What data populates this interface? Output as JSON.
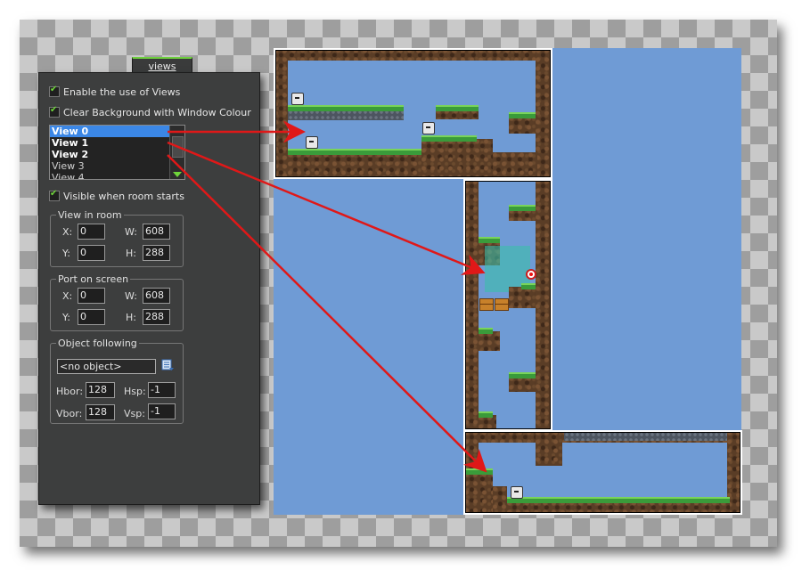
{
  "panel": {
    "tab_label": "views",
    "enable_views_label": "Enable the use of Views",
    "clear_background_label": "Clear Background with Window Colour",
    "views_list": [
      {
        "label": "View 0",
        "bold": true,
        "selected": true
      },
      {
        "label": "View 1",
        "bold": true,
        "selected": false
      },
      {
        "label": "View 2",
        "bold": true,
        "selected": false
      },
      {
        "label": "View 3",
        "bold": false,
        "selected": false
      },
      {
        "label": "View 4",
        "bold": false,
        "selected": false
      }
    ],
    "visible_label": "Visible when room starts",
    "view_in_room": {
      "title": "View in room",
      "x_label": "X:",
      "x_value": "0",
      "y_label": "Y:",
      "y_value": "0",
      "w_label": "W:",
      "w_value": "608",
      "h_label": "H:",
      "h_value": "288"
    },
    "port_on_screen": {
      "title": "Port on screen",
      "x_label": "X:",
      "x_value": "0",
      "y_label": "Y:",
      "y_value": "0",
      "w_label": "W:",
      "w_value": "608",
      "h_label": "H:",
      "h_value": "288"
    },
    "object_following": {
      "title": "Object following",
      "object_value": "<no object>",
      "hbor_label": "Hbor:",
      "hbor_value": "128",
      "hsp_label": "Hsp:",
      "hsp_value": "-1",
      "vbor_label": "Vbor:",
      "vbor_value": "128",
      "vsp_label": "Vsp:",
      "vsp_value": "-1"
    }
  },
  "colors": {
    "sky": "#6f9bd5",
    "arrow": "#e01818",
    "accent": "#6fcf3f",
    "selection": "#3b87e6"
  }
}
